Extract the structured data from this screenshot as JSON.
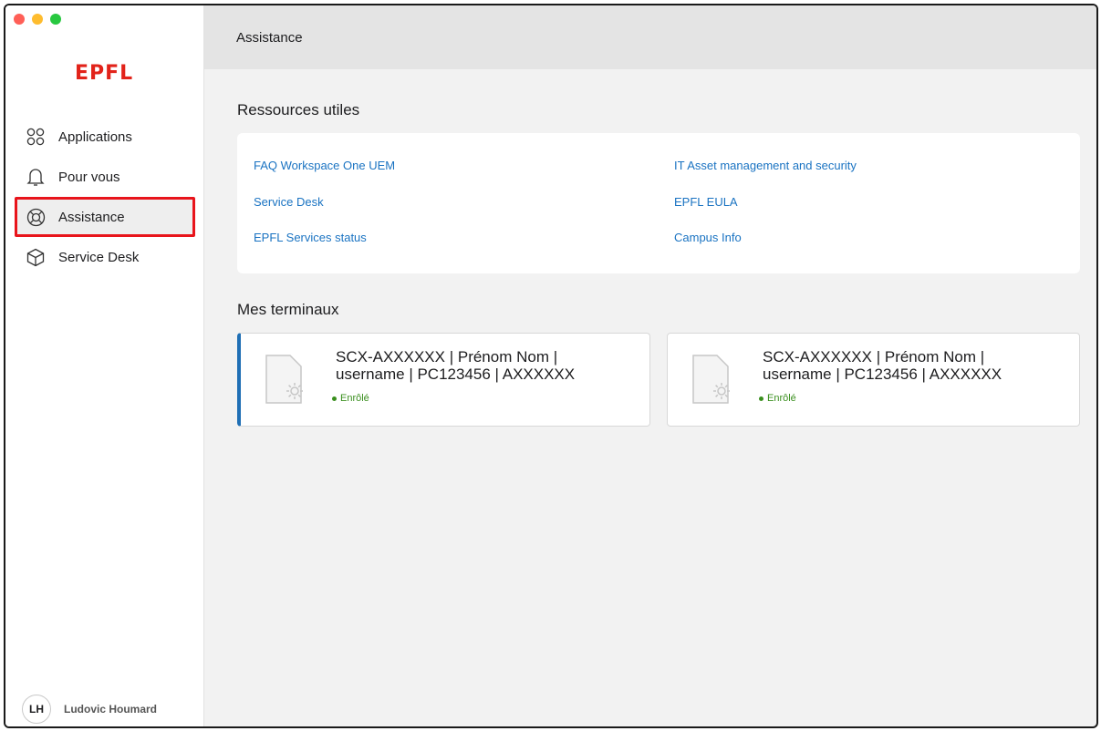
{
  "app": {
    "logo_text": "EPFL",
    "brand_color": "#e2231a",
    "accent_color": "#1f6fb5",
    "link_color": "#1a73c2"
  },
  "sidebar": {
    "items": [
      {
        "label": "Applications",
        "icon": "apps-grid-icon",
        "active": false
      },
      {
        "label": "Pour vous",
        "icon": "bell-icon",
        "active": false
      },
      {
        "label": "Assistance",
        "icon": "lifebuoy-icon",
        "active": true
      },
      {
        "label": "Service Desk",
        "icon": "box-icon",
        "active": false
      }
    ],
    "user": {
      "initials": "LH",
      "name": "Ludovic Houmard"
    }
  },
  "header": {
    "title": "Assistance"
  },
  "resources": {
    "title": "Ressources utiles",
    "links": [
      "FAQ Workspace One UEM",
      "IT Asset management and security",
      "Service Desk",
      "EPFL EULA",
      "EPFL Services status",
      "Campus Info"
    ]
  },
  "devices": {
    "title": "Mes terminaux",
    "items": [
      {
        "line1": "SCX-AXXXXXX | Prénom Nom |",
        "line2": "username | PC123456 | AXXXXXX",
        "status": "Enrôlé",
        "status_color": "#3a8f1e",
        "selected": true
      },
      {
        "line1": "SCX-AXXXXXX | Prénom Nom |",
        "line2": "username | PC123456 | AXXXXXX",
        "status": "Enrôlé",
        "status_color": "#3a8f1e",
        "selected": false
      }
    ]
  }
}
